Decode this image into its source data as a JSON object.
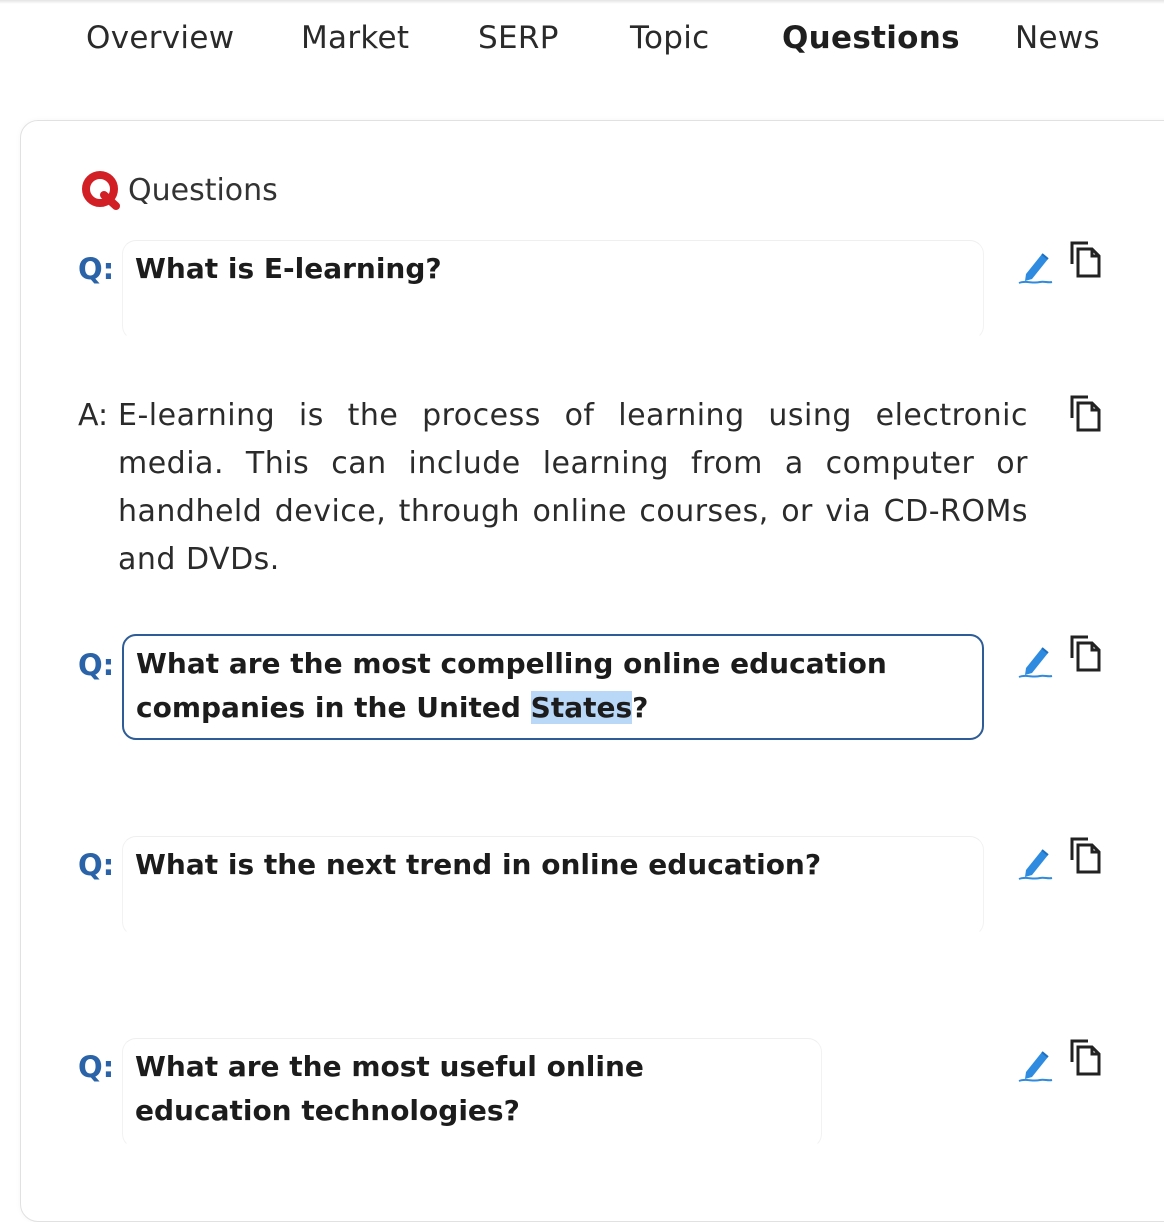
{
  "tabs": [
    {
      "label": "Overview",
      "active": false
    },
    {
      "label": "Market",
      "active": false
    },
    {
      "label": "SERP",
      "active": false
    },
    {
      "label": "Topic",
      "active": false
    },
    {
      "label": "Questions",
      "active": true
    },
    {
      "label": "News",
      "active": false
    }
  ],
  "section": {
    "title": "Questions",
    "icon": "questions-logo-icon"
  },
  "colors": {
    "accent_blue": "#2b63a8",
    "logo_red": "#d21f26",
    "focus_border": "#2e5c96",
    "selection": "#b9d7f7",
    "edit_icon": "#2f8be0"
  },
  "questions": [
    {
      "q_label": "Q:",
      "text": "What is E-learning?"
    },
    {
      "q_label": "Q:",
      "text_before": "What are the most compelling online education companies in the United ",
      "text_selected": "States",
      "text_after": "?"
    },
    {
      "q_label": "Q:",
      "text": "What is the next trend in online education?"
    },
    {
      "q_label": "Q:",
      "text": "What are the most useful online education technologies?"
    }
  ],
  "answer": {
    "a_label": "A:",
    "text": "E-learning is the process of learning using electronic media. This can include learning from a computer or handheld device, through online courses, or via CD-ROMs and DVDs."
  },
  "icons": {
    "edit": "pencil-edit-icon",
    "copy": "copy-icon"
  }
}
